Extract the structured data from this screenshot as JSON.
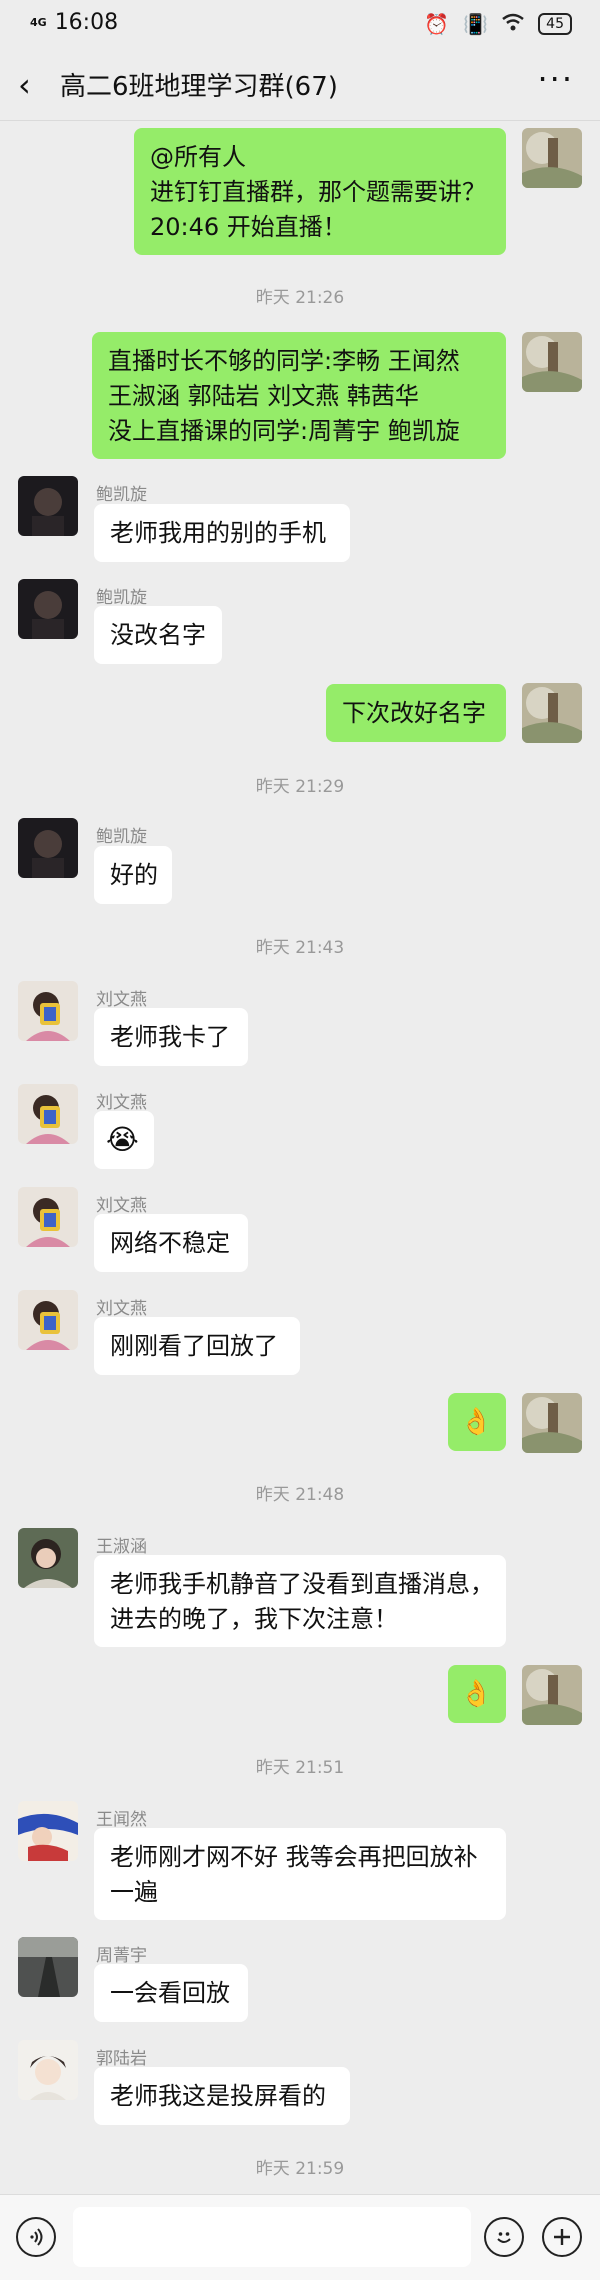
{
  "status_bar": {
    "time": "16:08",
    "network": "4G",
    "battery": "45"
  },
  "header": {
    "title": "高二6班地理学习群(67)",
    "back_icon": "chevron-left-icon",
    "more_icon": "more-icon"
  },
  "messages": [
    {
      "lines": [
        "@所有人",
        "进钉钉直播群，那个题需要讲？",
        "20:46 开始直播！"
      ]
    },
    {
      "timestamp": "昨天 21:26"
    },
    {
      "lines": [
        "直播时长不够的同学:李畅 王闻然",
        "王淑涵 郭陆岩 刘文燕 韩茜华",
        "没上直播课的同学:周菁宇 鲍凯旋"
      ]
    },
    {
      "sender": "鲍凯旋",
      "lines": [
        "老师我用的别的手机"
      ]
    },
    {
      "sender": "鲍凯旋",
      "lines": [
        "没改名字"
      ]
    },
    {
      "lines": [
        "下次改好名字"
      ]
    },
    {
      "timestamp": "昨天 21:29"
    },
    {
      "sender": "鲍凯旋",
      "lines": [
        "好的"
      ]
    },
    {
      "timestamp": "昨天 21:43"
    },
    {
      "sender": "刘文燕",
      "lines": [
        "老师我卡了"
      ]
    },
    {
      "sender": "刘文燕",
      "emoji": "😭"
    },
    {
      "sender": "刘文燕",
      "lines": [
        "网络不稳定"
      ]
    },
    {
      "sender": "刘文燕",
      "lines": [
        "刚刚看了回放了"
      ]
    },
    {
      "emoji": "👌"
    },
    {
      "timestamp": "昨天 21:48"
    },
    {
      "sender": "王淑涵",
      "lines": [
        "老师我手机静音了没看到直播消息，",
        "进去的晚了，我下次注意！"
      ]
    },
    {
      "emoji": "👌"
    },
    {
      "timestamp": "昨天 21:51"
    },
    {
      "sender": "王闻然",
      "lines": [
        "老师刚才网不好 我等会再把回放补",
        "一遍"
      ]
    },
    {
      "sender": "周菁宇",
      "lines": [
        "一会看回放"
      ]
    },
    {
      "sender": "郭陆岩",
      "lines": [
        "老师我这是投屏看的"
      ]
    },
    {
      "timestamp": "昨天 21:59"
    }
  ],
  "input_bar": {
    "voice_icon": "voice-icon",
    "emoji_icon": "emoji-icon",
    "plus_icon": "plus-icon"
  },
  "colors": {
    "background": "#EDEDED",
    "my_bubble": "#95EC69",
    "other_bubble": "#FFFFFF"
  }
}
